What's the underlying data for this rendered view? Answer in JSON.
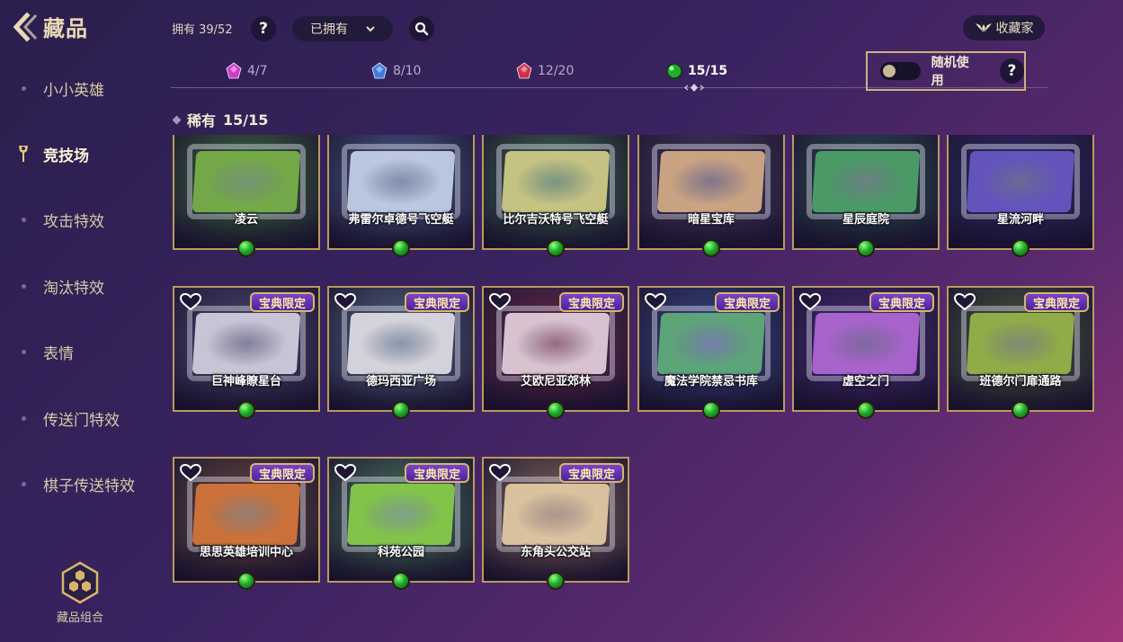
{
  "header": {
    "title": "藏品",
    "owned_text": "拥有 39/52",
    "help_glyph": "?",
    "filter_value": "已拥有",
    "collector_label": "收藏家"
  },
  "sidebar": {
    "items": [
      {
        "label": "小小英雄",
        "active": false
      },
      {
        "label": "竞技场",
        "active": true
      },
      {
        "label": "攻击特效",
        "active": false
      },
      {
        "label": "淘汰特效",
        "active": false
      },
      {
        "label": "表情",
        "active": false
      },
      {
        "label": "传送门特效",
        "active": false
      },
      {
        "label": "棋子传送特效",
        "active": false
      }
    ],
    "combo_label": "藏品组合"
  },
  "tabs": [
    {
      "label": "4/7",
      "gem_color": "#d63fd0",
      "active": false
    },
    {
      "label": "8/10",
      "gem_color": "#3f7fe8",
      "active": false
    },
    {
      "label": "12/20",
      "gem_color": "#d8324a",
      "active": false
    },
    {
      "label": "15/15",
      "gem_color": "#1fae2a",
      "active": true
    }
  ],
  "random_use": {
    "label": "随机使用",
    "on": false,
    "help_glyph": "?"
  },
  "section": {
    "title": "稀有",
    "count": "15/15"
  },
  "badge_text": "宝典限定",
  "cards": [
    {
      "name": "凌云",
      "limited": false,
      "board": "#7bb34a",
      "bg": "#3c6a3a"
    },
    {
      "name": "弗雷尔卓德号飞空艇",
      "limited": false,
      "board": "#c9d6ec",
      "bg": "#4a5e8c"
    },
    {
      "name": "比尔吉沃特号飞空艇",
      "limited": false,
      "board": "#d6d08a",
      "bg": "#3e6a4c"
    },
    {
      "name": "暗星宝库",
      "limited": false,
      "board": "#d9b088",
      "bg": "#4a3a5c"
    },
    {
      "name": "星辰庭院",
      "limited": false,
      "board": "#4fa56a",
      "bg": "#2b4e4e"
    },
    {
      "name": "星流河畔",
      "limited": false,
      "board": "#6a5ac8",
      "bg": "#2e2a6a"
    },
    {
      "name": "巨神峰瞭星台",
      "limited": true,
      "board": "#d8d4e4",
      "bg": "#4c4a72"
    },
    {
      "name": "德玛西亚广场",
      "limited": true,
      "board": "#e4e2e8",
      "bg": "#566a86"
    },
    {
      "name": "艾欧尼亚郊林",
      "limited": true,
      "board": "#e7d4e0",
      "bg": "#6a2a4a"
    },
    {
      "name": "魔法学院禁忌书库",
      "limited": true,
      "board": "#62b07a",
      "bg": "#3a4a8a"
    },
    {
      "name": "虚空之门",
      "limited": true,
      "board": "#b46ad8",
      "bg": "#4a2a7a"
    },
    {
      "name": "班德尔门扉通路",
      "limited": true,
      "board": "#9ab84a",
      "bg": "#4a5a3a"
    },
    {
      "name": "思思英雄培训中心",
      "limited": true,
      "board": "#d9783a",
      "bg": "#6a4a3a"
    },
    {
      "name": "科苑公园",
      "limited": true,
      "board": "#8ad04a",
      "bg": "#4a7a5a"
    },
    {
      "name": "东角头公交站",
      "limited": true,
      "board": "#e6cfa8",
      "bg": "#8a6a5a"
    }
  ]
}
